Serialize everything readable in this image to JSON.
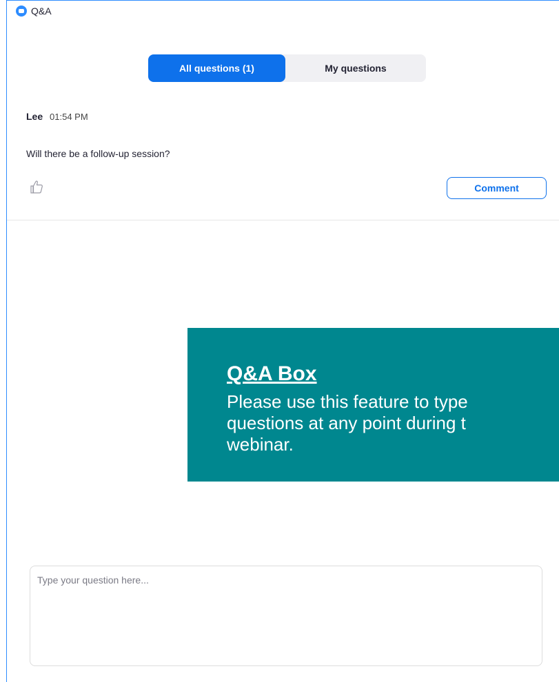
{
  "window": {
    "title": "Q&A",
    "app_icon": "zoom-app-icon",
    "accent_color": "#2d8cff"
  },
  "tabs": [
    {
      "label": "All questions (1)",
      "active": true
    },
    {
      "label": "My questions",
      "active": false
    }
  ],
  "question": {
    "author": "Lee",
    "time": "01:54 PM",
    "text": "Will there be a follow-up session?",
    "like_icon": "thumbs-up-icon",
    "comment_label": "Comment"
  },
  "callout": {
    "title": "Q&A Box",
    "body_lines": [
      "Please use this feature to type",
      "questions at any point during t",
      "webinar."
    ],
    "background_color": "#00878f"
  },
  "composer": {
    "placeholder": "Type your question here..."
  }
}
